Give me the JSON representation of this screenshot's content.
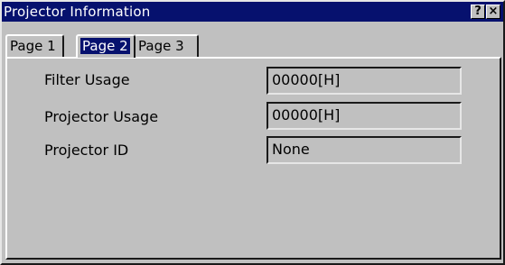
{
  "window": {
    "title": "Projector Information",
    "help_button": "?",
    "close_button": "×"
  },
  "tabs": [
    {
      "label": "Page 1",
      "selected": false
    },
    {
      "label": "Page 2",
      "selected": true
    },
    {
      "label": "Page 3",
      "selected": false
    }
  ],
  "fields": [
    {
      "label": "Filter Usage",
      "value": "00000[H]"
    },
    {
      "label": "Projector Usage",
      "value": "00000[H]"
    },
    {
      "label": "Projector ID",
      "value": "None"
    }
  ],
  "colors": {
    "titlebar": "#06116e",
    "face": "#c0c0c0",
    "highlight_text": "#ffffff"
  }
}
